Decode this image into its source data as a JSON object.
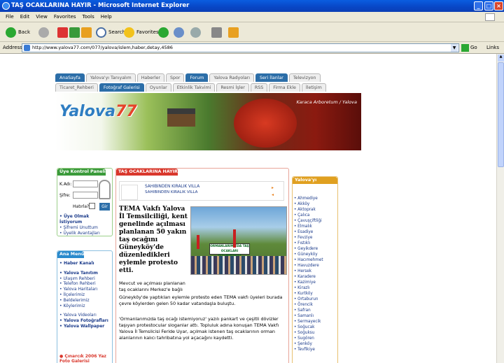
{
  "window": {
    "title": "TAŞ OCAKLARINA HAYIR - Microsoft Internet Explorer"
  },
  "menu": [
    "File",
    "Edit",
    "View",
    "Favorites",
    "Tools",
    "Help"
  ],
  "toolbar": {
    "back": "Back",
    "search": "Search",
    "favorites": "Favorites"
  },
  "address": {
    "label": "Address",
    "url": "http://www.yalova77.com/077/yalova/islem,haber,detay,4586",
    "go": "Go",
    "links": "Links"
  },
  "nav": {
    "row1": [
      "AnaSayfa",
      "Yalova'yı Tanıyalım",
      "Haberler",
      "Spor",
      "Forum",
      "Yalova Radyoları",
      "Seri İlanlar",
      "Televizyon"
    ],
    "row2": [
      "Ticaret_Rehberi",
      "Fotoğraf Galerisi",
      "Oyunlar",
      "Etkinlik Takvimi",
      "Resmi İşler",
      "RSS",
      "Firma Ekle",
      "İletişim"
    ]
  },
  "banner": {
    "logo_main": "Yalova",
    "logo_num": "77",
    "caption": "Karaca Arboretum / Yalova"
  },
  "login": {
    "title": "Üye Kontrol Paneli",
    "user_label": "K.Adı:",
    "pass_label": "Şifre:",
    "remember": "Hatırla?",
    "go": "Gir",
    "links": [
      "Üye Olmak İstiyorum",
      "Şifremi Unuttum",
      "Üyelik Avantajları"
    ]
  },
  "menu_panel": {
    "title": "Ana Menü",
    "items": [
      {
        "t": "Haber Kanalı",
        "b": true,
        "sp": false
      },
      {
        "t": "Yalova Tanıtım",
        "b": true,
        "sp": true
      },
      {
        "t": "Ulaşım Rehberi",
        "b": false,
        "sp": false
      },
      {
        "t": "Telefon Rehberi",
        "b": false,
        "sp": false
      },
      {
        "t": "Yalova Haritaları",
        "b": false,
        "sp": false
      },
      {
        "t": "İlçelerimiz",
        "b": false,
        "sp": false
      },
      {
        "t": "Beldelerimiz",
        "b": false,
        "sp": false
      },
      {
        "t": "Köylerimiz",
        "b": false,
        "sp": false
      },
      {
        "t": "Yalova Videoları",
        "b": false,
        "sp": true
      },
      {
        "t": "Yalova Fotoğrafları",
        "b": true,
        "sp": false
      },
      {
        "t": "Yalova Wallpaper",
        "b": true,
        "sp": false
      }
    ],
    "promo": "Çınarcık 2006 Yaz Foto Galerisi"
  },
  "main": {
    "header": "TAŞ OCAKLARINA HAYIR",
    "ad_line1": "SAHIBINDEN  KIRALIK VILLA",
    "ad_line2": "SAHIBINDEN KIRALIK VILLA",
    "headline": "TEMA Vakfı Yalova İl Temsilciliği, kent genelinde açılması planlanan 50 yakın taş ocağını Güneyköy'de düzenledikleri eylemle protesto etti.",
    "intro": "Mevcut ve açılması planlanan taş ocaklarını Merkez'e bağlı",
    "p1": "Güneyköy'de yaptıkları eylemle protesto eden TEMA vakfı üyeleri burada çevre köylerden gelen 50 kadar vatandaşla buluştu.",
    "p2": "'Ormanlarımızda taş ocağı istemiyoruz' yazılı pankart ve çeşitli dövizler taşıyan protestocular sloganlar attı. Topluluk adına konuşan TEMA Vakfı Yalova İl Temsilcisi Feride Uyar, açılmak istenen taş ocaklarının orman alanlarının kalıcı tahribatına yol açacağını kaydetti.",
    "photo_banner": "ORMANLARIMIZDA TAŞ OCAKLARI İSTEMİYORUZ"
  },
  "right": {
    "title": "Yalova'yı Tanıyalım",
    "items": [
      "Ahmediye",
      "Akköy",
      "Aktoprak",
      "Çalıca",
      "Çavuşçiftliği",
      "Elmalık",
      "Esadiye",
      "Fevziye",
      "Fıstıklı",
      "Geyikdere",
      "Güneyköy",
      "Hacımehmet",
      "Havuzdere",
      "Hersek",
      "Karadere",
      "Kazimiye",
      "Kirazlı",
      "Kurtköy",
      "Ortaburun",
      "Örencik",
      "Safran",
      "Samanlı",
      "Sermayecik",
      "Soğucak",
      "Soğuksu",
      "Sugören",
      "Şenköy",
      "Tevfikiye"
    ]
  },
  "colors": {
    "title": "#0a5de0",
    "tab_active": "#2c6ea8",
    "panel_head": "#3a9a3a",
    "menu_head": "#2a8acc",
    "main_head": "#d9372c",
    "right_head": "#e0a020"
  }
}
